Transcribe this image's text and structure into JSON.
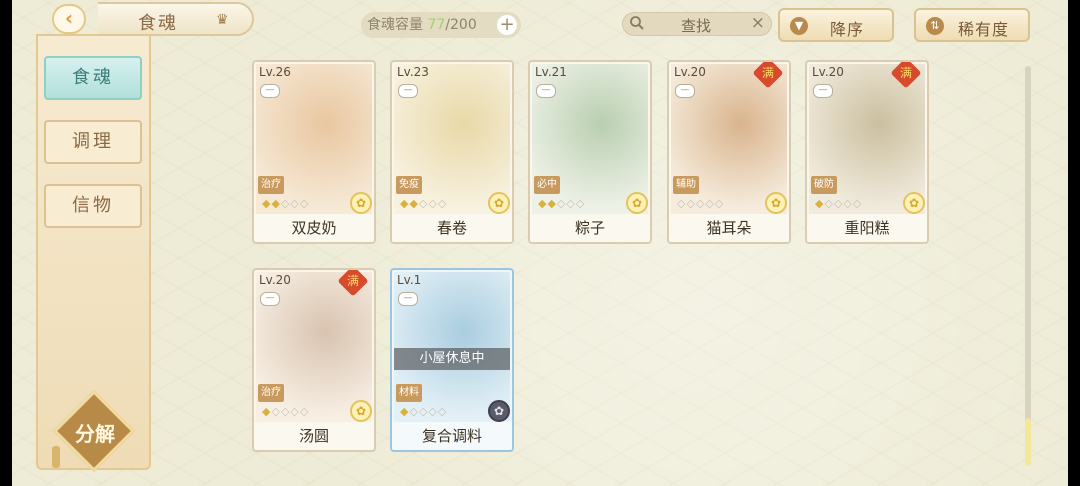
{
  "header": {
    "back_icon": "back-chevron-icon",
    "title": "食魂",
    "title_icon": "crown-icon",
    "capacity_label": "食魂容量",
    "capacity_current": "77",
    "capacity_max": "/200",
    "capacity_add_icon": "plus-icon",
    "search_icon": "magnifier-icon",
    "search_placeholder": "查找",
    "search_clear": "×",
    "sort_order_label": "降序",
    "sort_order_icon": "triangle-down-icon",
    "sort_key_label": "稀有度",
    "sort_key_icon": "swap-icon"
  },
  "sidebar": {
    "items": [
      {
        "label": "食魂",
        "active": true
      },
      {
        "label": "调理",
        "active": false
      },
      {
        "label": "信物",
        "active": false
      }
    ],
    "decompose_label": "分解"
  },
  "cards": [
    {
      "level": "Lv.26",
      "full_badge": "",
      "role": "治疗",
      "stars_filled": 2,
      "stars_total": 5,
      "name": "双皮奶",
      "frame": "normal",
      "status": ""
    },
    {
      "level": "Lv.23",
      "full_badge": "",
      "role": "免疫",
      "stars_filled": 2,
      "stars_total": 5,
      "name": "春卷",
      "frame": "normal",
      "status": ""
    },
    {
      "level": "Lv.21",
      "full_badge": "",
      "role": "必中",
      "stars_filled": 2,
      "stars_total": 5,
      "name": "粽子",
      "frame": "normal",
      "status": ""
    },
    {
      "level": "Lv.20",
      "full_badge": "满",
      "role": "辅助",
      "stars_filled": 0,
      "stars_total": 5,
      "name": "猫耳朵",
      "frame": "normal",
      "status": ""
    },
    {
      "level": "Lv.20",
      "full_badge": "满",
      "role": "破防",
      "stars_filled": 1,
      "stars_total": 5,
      "name": "重阳糕",
      "frame": "normal",
      "status": ""
    },
    {
      "level": "Lv.20",
      "full_badge": "满",
      "role": "治疗",
      "stars_filled": 1,
      "stars_total": 5,
      "name": "汤圆",
      "frame": "normal",
      "status": ""
    },
    {
      "level": "Lv.1",
      "full_badge": "",
      "role": "材料",
      "stars_filled": 1,
      "stars_total": 5,
      "name": "复合调料",
      "frame": "blue",
      "status": "小屋休息中"
    }
  ],
  "colors": {
    "accent_teal": "#b2e0db",
    "gold": "#d8b13f",
    "full_badge_red": "#d74a2b",
    "capacity_green": "#a2d36b"
  }
}
